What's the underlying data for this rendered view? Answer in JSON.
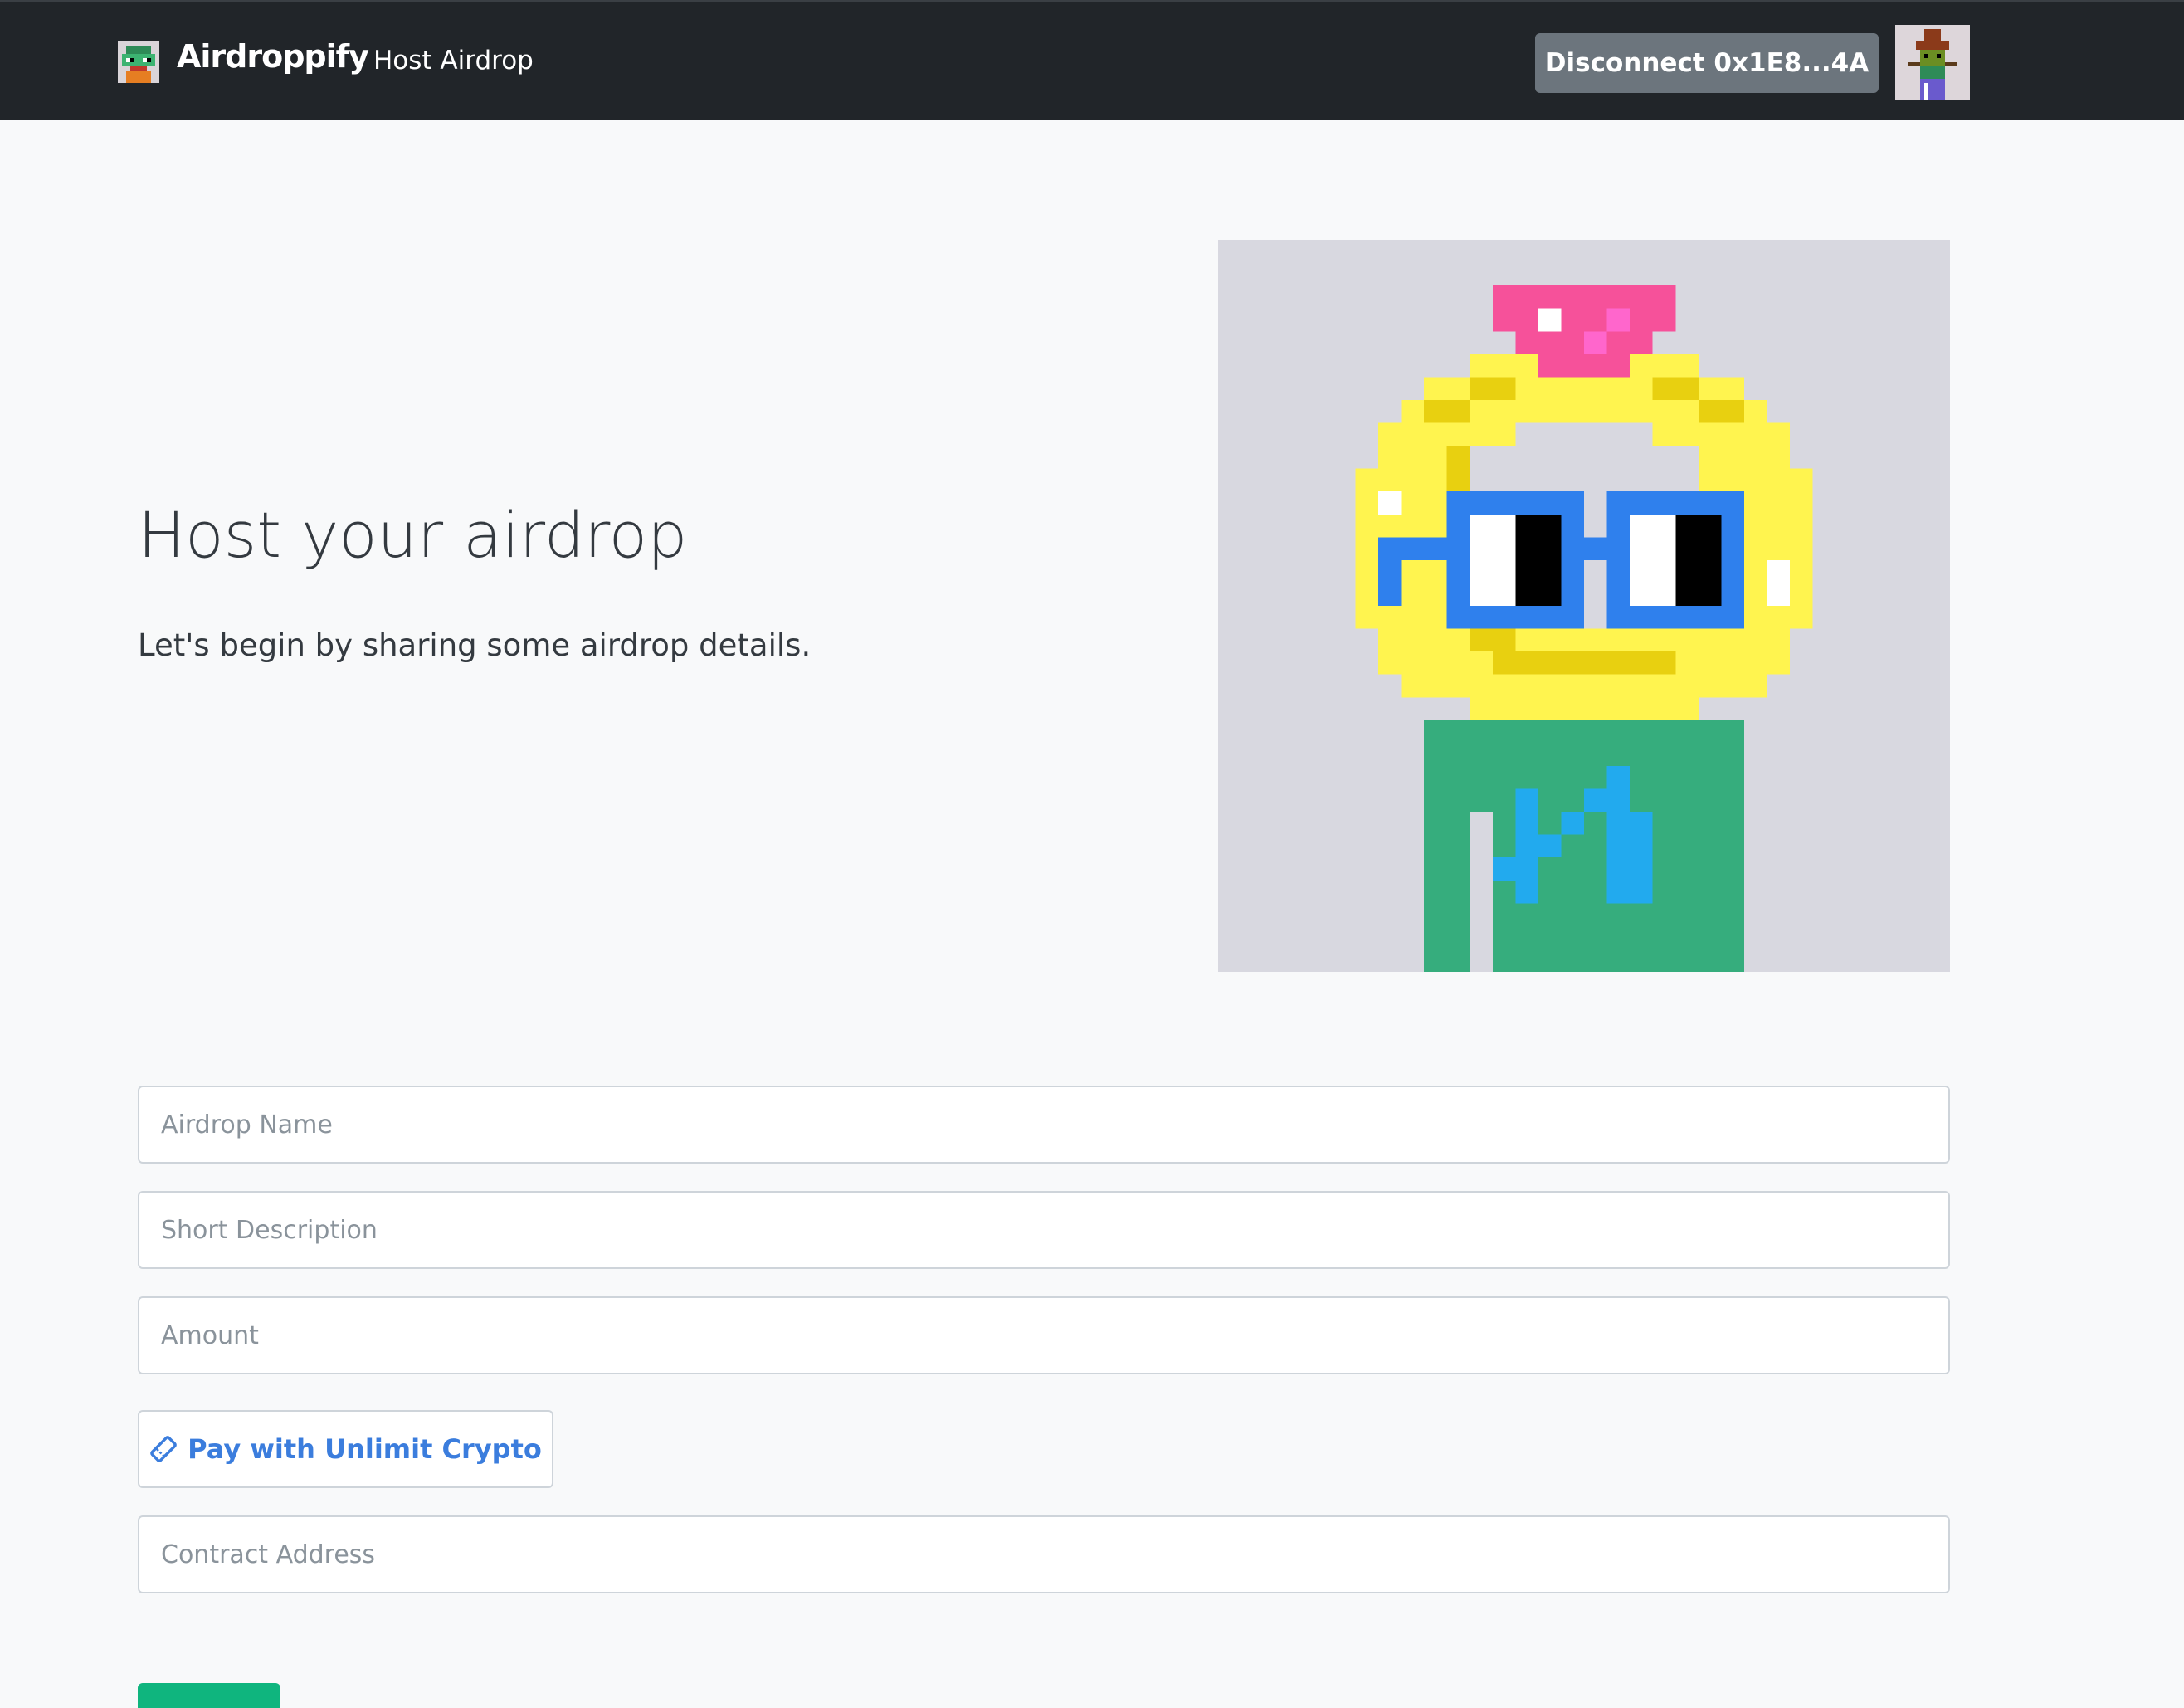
{
  "navbar": {
    "brand": "Airdroppify",
    "nav_link": "Host Airdrop",
    "disconnect_label": "Disconnect 0x1E8...4A"
  },
  "hero": {
    "title": "Host your airdrop",
    "subtitle": "Let's begin by sharing some airdrop details."
  },
  "form": {
    "airdrop_name_placeholder": "Airdrop Name",
    "short_description_placeholder": "Short Description",
    "amount_placeholder": "Amount",
    "pay_button_label": "Pay with Unlimit Crypto",
    "pay_button_icon": "ticket-icon",
    "contract_address_placeholder": "Contract Address"
  },
  "colors": {
    "navbar_bg": "#212529",
    "page_bg": "#f8f9fa",
    "disconnect_bg": "#6c757d",
    "accent_blue": "#3b7ddd",
    "submit_green": "#0fb57e"
  }
}
